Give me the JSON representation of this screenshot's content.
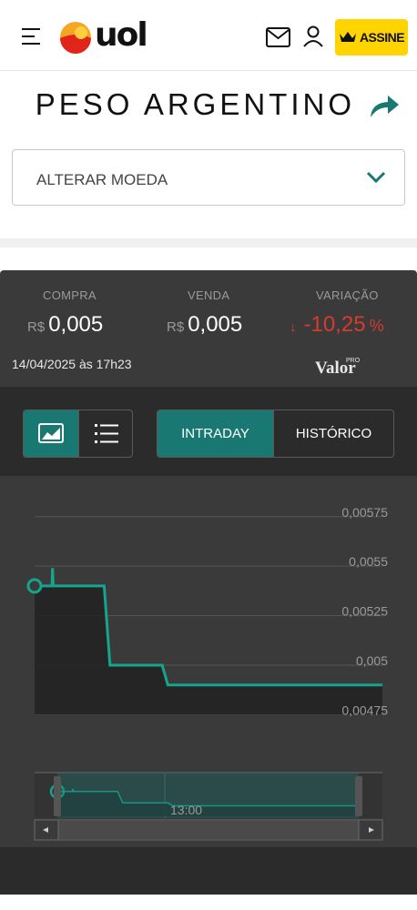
{
  "header": {
    "logo_text": "uol",
    "assine_label": "ASSINE",
    "accent": "#ffd400"
  },
  "page": {
    "title": "PESO ARGENTINO"
  },
  "currency_select": {
    "label": "ALTERAR MOEDA"
  },
  "quote": {
    "compra_label": "COMPRA",
    "venda_label": "VENDA",
    "variacao_label": "VARIAÇÃO",
    "currency_symbol": "R$",
    "compra_value": "0,005",
    "venda_value": "0,005",
    "variation_arrow": "↓",
    "variation_value": "-10,25",
    "variation_unit": "%",
    "timestamp": "14/04/2025 às 17h23",
    "source_logo_text": "Valor",
    "source_logo_sup": "PRO",
    "negative_color": "#d63b2f"
  },
  "controls": {
    "intraday_label": "INTRADAY",
    "historico_label": "HISTÓRICO",
    "active_color": "#1a7873"
  },
  "chart_data": {
    "type": "area",
    "title": "",
    "xlabel": "",
    "ylabel": "",
    "ylim": [
      0.0046,
      0.00585
    ],
    "y_ticks": [
      "0,00575",
      "0,0055",
      "0,00525",
      "0,005",
      "0,00475"
    ],
    "y_tick_values": [
      0.00575,
      0.0055,
      0.00525,
      0.005,
      0.00475
    ],
    "navigator_label": "13:00",
    "series": [
      {
        "x": [
          0,
          0.3,
          0.31,
          0.32,
          0.4,
          1.0,
          1.1,
          1.2,
          1.3,
          1.45,
          2.2,
          2.3,
          2.6,
          3.2,
          4.0,
          5.0,
          5.5,
          6.0
        ],
        "y": [
          0.0054,
          0.0054,
          0.00549,
          0.0054,
          0.0054,
          0.0054,
          0.0054,
          0.0054,
          0.005,
          0.005,
          0.005,
          0.0049,
          0.0049,
          0.0049,
          0.0049,
          0.0049,
          0.0049,
          0.0049
        ]
      }
    ],
    "line_color": "#16a58c"
  }
}
